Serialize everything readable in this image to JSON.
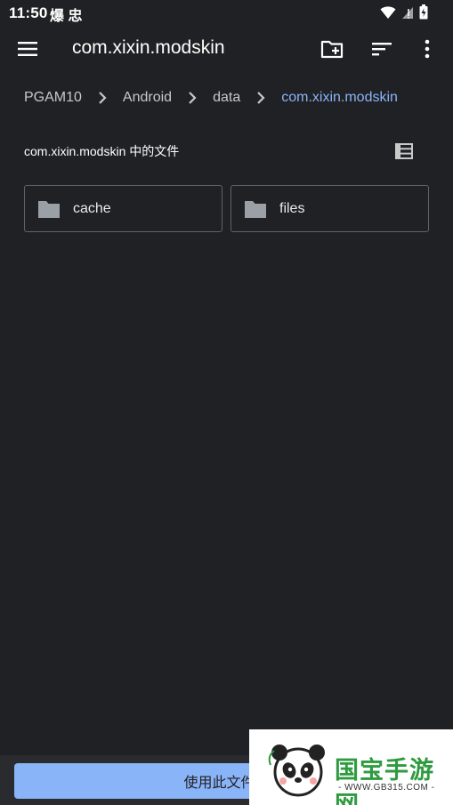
{
  "status_bar": {
    "time": "11:50",
    "notification_glyphs": "爆 忠"
  },
  "app_bar": {
    "title": "com.xixin.modskin",
    "menu_icon": "menu-icon",
    "new_folder_icon": "create-new-folder-icon",
    "sort_icon": "sort-icon",
    "more_icon": "more-vert-icon"
  },
  "breadcrumb": {
    "items": [
      "PGAM10",
      "Android",
      "data",
      "com.xixin.modskin"
    ]
  },
  "section": {
    "header": "com.xixin.modskin 中的文件",
    "view_toggle_icon": "list-view-icon"
  },
  "folders": [
    {
      "name": "cache",
      "icon": "folder-icon"
    },
    {
      "name": "files",
      "icon": "folder-icon"
    }
  ],
  "bottom": {
    "button_label": "使用此文件夹"
  },
  "watermark": {
    "brand": "国宝手游网",
    "url": "- WWW.GB315.COM -"
  },
  "colors": {
    "background": "#202124",
    "accent": "#8ab4f8",
    "text": "#e8eaed",
    "card_border": "#5f6368"
  }
}
